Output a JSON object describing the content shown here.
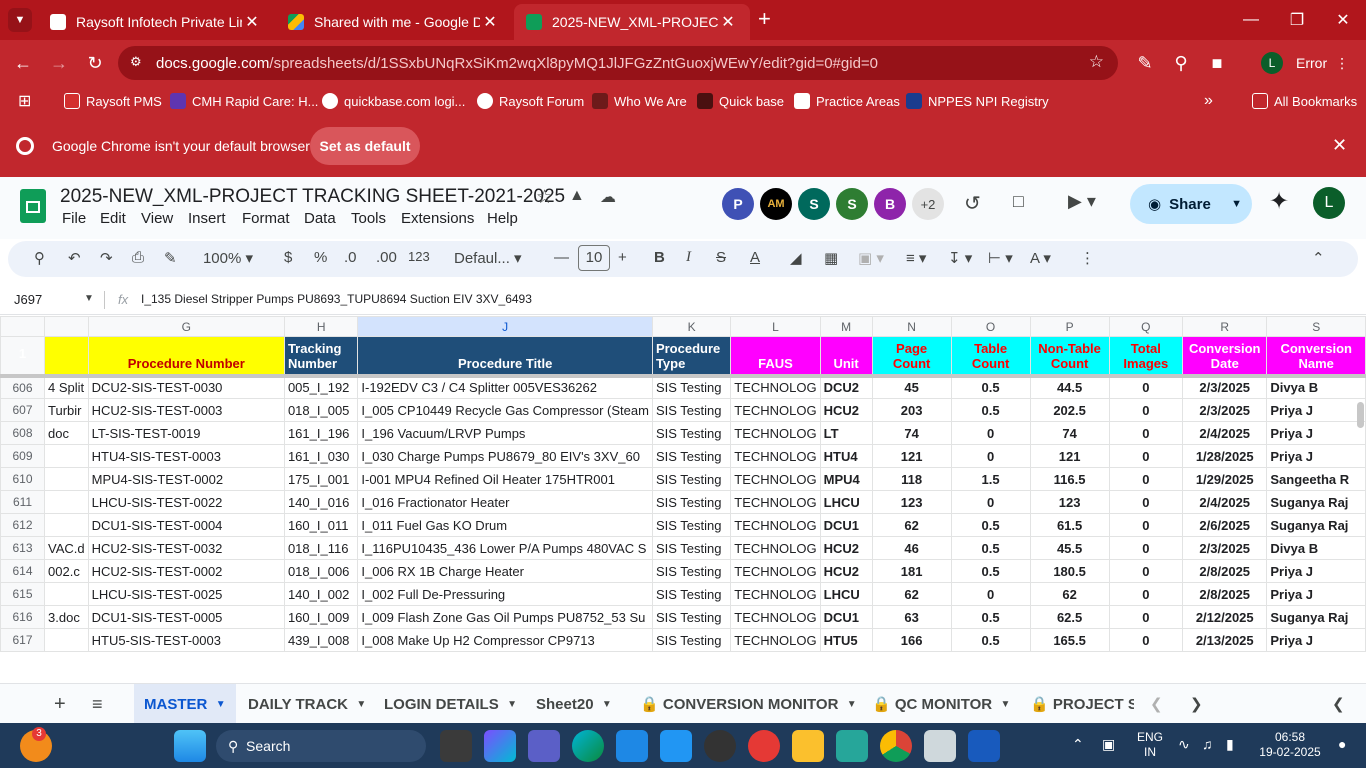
{
  "browser": {
    "tabs": [
      {
        "title": "Raysoft Infotech Private Limited",
        "color": "#ffffff"
      },
      {
        "title": "Shared with me - Google Drive",
        "color": "#fbbc04"
      },
      {
        "title": "2025-NEW_XML-PROJECT TRAC",
        "color": "#0f9d58"
      }
    ],
    "url_host": "docs.google.com",
    "url_path": "/spreadsheets/d/1SSxbUNqRxSiKm2wqXl8pyMQ1JlJFGzZntGuoxjWEwY/edit?gid=0#gid=0",
    "profile_initial": "L",
    "error_label": "Error",
    "bookmarks": [
      "Raysoft PMS",
      "CMH Rapid Care: H...",
      "quickbase.com logi...",
      "Raysoft Forum",
      "Who We Are",
      "Quick base",
      "Practice Areas",
      "NPPES NPI Registry"
    ],
    "all_bookmarks": "All Bookmarks",
    "infobar_text": "Google Chrome isn't your default browser",
    "set_default": "Set as default"
  },
  "sheet": {
    "title": "2025-NEW_XML-PROJECT TRACKING SHEET-2021-2025",
    "menus": [
      "File",
      "Edit",
      "View",
      "Insert",
      "Format",
      "Data",
      "Tools",
      "Extensions",
      "Help"
    ],
    "avatars": [
      {
        "letter": "P",
        "color": "#3f51b5"
      },
      {
        "letter": "AM",
        "color": "#000000"
      },
      {
        "letter": "S",
        "color": "#00695c"
      },
      {
        "letter": "S",
        "color": "#2e7d32"
      },
      {
        "letter": "B",
        "color": "#8e24aa"
      }
    ],
    "extra_collaborators": "+2",
    "share_label": "Share",
    "user_initial": "L",
    "zoom": "100%",
    "currency": "$",
    "percent": "%",
    "dec_less": ".0",
    "dec_more": ".00",
    "num_fmt": "123",
    "font": "Defaul...",
    "font_size": "10",
    "cell_ref": "J697",
    "fx": "fx",
    "formula": "I_135 Diesel Stripper Pumps PU8693_TUPU8694 Suction EIV 3XV_6493"
  },
  "grid": {
    "columns": [
      "G",
      "H",
      "J",
      "K",
      "L",
      "M",
      "N",
      "O",
      "P",
      "Q",
      "R",
      "S"
    ],
    "header_row": "1",
    "headers": [
      "Procedure Number",
      "Tracking Number",
      "Procedure Title",
      "Procedure Type",
      "FAUS",
      "Unit",
      "Page Count",
      "Table Count",
      "Non-Table Count",
      "Total Images",
      "Conversion Date",
      "Conversion Name"
    ],
    "rows": [
      {
        "n": "606",
        "f": "4 Split",
        "g": "DCU2-SIS-TEST-0030",
        "h": "005_I_192",
        "j": "I-192EDV C3 / C4 Splitter 005VES36262",
        "k": "SIS Testing",
        "l": "TECHNOLOG",
        "m": "DCU2",
        "np": "45",
        "o": "0.5",
        "p": "44.5",
        "q": "0",
        "r": "2/3/2025",
        "s": "Divya B"
      },
      {
        "n": "607",
        "f": "Turbir",
        "g": "HCU2-SIS-TEST-0003",
        "h": "018_I_005",
        "j": "I_005 CP10449 Recycle Gas Compressor (Steam",
        "k": "SIS Testing",
        "l": "TECHNOLOG",
        "m": "HCU2",
        "np": "203",
        "o": "0.5",
        "p": "202.5",
        "q": "0",
        "r": "2/3/2025",
        "s": "Priya J"
      },
      {
        "n": "608",
        "f": "doc",
        "g": "LT-SIS-TEST-0019",
        "h": "161_I_196",
        "j": "I_196 Vacuum/LRVP Pumps",
        "k": "SIS Testing",
        "l": "TECHNOLOG",
        "m": "LT",
        "np": "74",
        "o": "0",
        "p": "74",
        "q": "0",
        "r": "2/4/2025",
        "s": "Priya J"
      },
      {
        "n": "609",
        "f": "",
        "g": "HTU4-SIS-TEST-0003",
        "h": "161_I_030",
        "j": "I_030 Charge Pumps PU8679_80 EIV's 3XV_60",
        "k": "SIS Testing",
        "l": "TECHNOLOG",
        "m": "HTU4",
        "np": "121",
        "o": "0",
        "p": "121",
        "q": "0",
        "r": "1/28/2025",
        "s": "Priya J"
      },
      {
        "n": "610",
        "f": "",
        "g": "MPU4-SIS-TEST-0002",
        "h": "175_I_001",
        "j": "I-001 MPU4 Refined Oil Heater 175HTR001",
        "k": "SIS Testing",
        "l": "TECHNOLOG",
        "m": "MPU4",
        "np": "118",
        "o": "1.5",
        "p": "116.5",
        "q": "0",
        "r": "1/29/2025",
        "s": "Sangeetha R"
      },
      {
        "n": "611",
        "f": "",
        "g": "LHCU-SIS-TEST-0022",
        "h": "140_I_016",
        "j": "I_016 Fractionator Heater",
        "k": "SIS Testing",
        "l": "TECHNOLOG",
        "m": "LHCU",
        "np": "123",
        "o": "0",
        "p": "123",
        "q": "0",
        "r": "2/4/2025",
        "s": "Suganya Raj"
      },
      {
        "n": "612",
        "f": "",
        "g": "DCU1-SIS-TEST-0004",
        "h": "160_I_011",
        "j": "I_011 Fuel Gas KO Drum",
        "k": "SIS Testing",
        "l": "TECHNOLOG",
        "m": "DCU1",
        "np": "62",
        "o": "0.5",
        "p": "61.5",
        "q": "0",
        "r": "2/6/2025",
        "s": "Suganya Raj"
      },
      {
        "n": "613",
        "f": "VAC.d",
        "g": "HCU2-SIS-TEST-0032",
        "h": "018_I_116",
        "j": "I_116PU10435_436 Lower P/A Pumps 480VAC S",
        "k": "SIS Testing",
        "l": "TECHNOLOG",
        "m": "HCU2",
        "np": "46",
        "o": "0.5",
        "p": "45.5",
        "q": "0",
        "r": "2/3/2025",
        "s": "Divya B"
      },
      {
        "n": "614",
        "f": "002.c",
        "g": "HCU2-SIS-TEST-0002",
        "h": "018_I_006",
        "j": "I_006 RX 1B Charge Heater",
        "k": "SIS Testing",
        "l": "TECHNOLOG",
        "m": "HCU2",
        "np": "181",
        "o": "0.5",
        "p": "180.5",
        "q": "0",
        "r": "2/8/2025",
        "s": "Priya J"
      },
      {
        "n": "615",
        "f": "",
        "g": "LHCU-SIS-TEST-0025",
        "h": "140_I_002",
        "j": "I_002 Full De-Pressuring",
        "k": "SIS Testing",
        "l": "TECHNOLOG",
        "m": "LHCU",
        "np": "62",
        "o": "0",
        "p": "62",
        "q": "0",
        "r": "2/8/2025",
        "s": "Priya J"
      },
      {
        "n": "616",
        "f": "3.doc",
        "g": "DCU1-SIS-TEST-0005",
        "h": "160_I_009",
        "j": "I_009 Flash Zone Gas Oil Pumps PU8752_53 Su",
        "k": "SIS Testing",
        "l": "TECHNOLOG",
        "m": "DCU1",
        "np": "63",
        "o": "0.5",
        "p": "62.5",
        "q": "0",
        "r": "2/12/2025",
        "s": "Suganya Raj"
      },
      {
        "n": "617",
        "f": "",
        "g": "HTU5-SIS-TEST-0003",
        "h": "439_I_008",
        "j": "I_008 Make Up H2 Compressor CP9713",
        "k": "SIS Testing",
        "l": "TECHNOLOG",
        "m": "HTU5",
        "np": "166",
        "o": "0.5",
        "p": "165.5",
        "q": "0",
        "r": "2/13/2025",
        "s": "Priya J"
      }
    ]
  },
  "sheet_tabs": [
    "MASTER",
    "DAILY TRACK",
    "LOGIN DETAILS",
    "Sheet20",
    "CONVERSION MONITOR",
    "QC MONITOR",
    "PROJECT SU"
  ],
  "taskbar": {
    "search": "Search",
    "badge": "3",
    "lang1": "ENG",
    "lang2": "IN",
    "time": "06:58",
    "date": "19-02-2025"
  }
}
